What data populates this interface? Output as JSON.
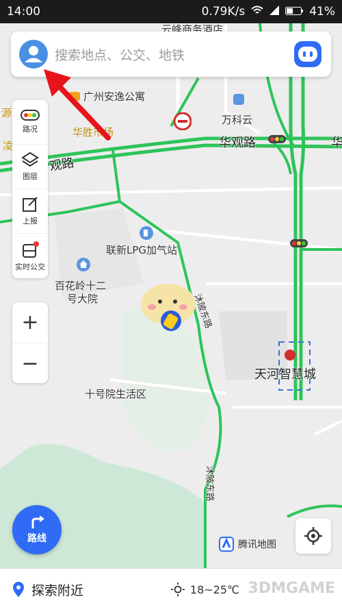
{
  "status_bar": {
    "time": "14:00",
    "network_speed": "0.79K/s",
    "battery": "41%"
  },
  "search": {
    "placeholder": "搜索地点、公交、地铁"
  },
  "side_panel": {
    "items": [
      {
        "label": "路况",
        "icon": "traffic-light-icon"
      },
      {
        "label": "图层",
        "icon": "layers-icon"
      },
      {
        "label": "上报",
        "icon": "edit-report-icon"
      },
      {
        "label": "实时公交",
        "icon": "bus-icon"
      }
    ]
  },
  "zoom": {
    "in": "+",
    "out": "−"
  },
  "route_button": {
    "label": "路线"
  },
  "map_labels": {
    "hotel": "云峰商务酒店",
    "apartment": "广州安逸公寓",
    "market": "华胜市场",
    "wanke": "万科云",
    "huaguan_road_east": "华观路",
    "huaguan_road_west": "观路",
    "lpg": "联新LPG加气站",
    "baihualing": "百花岭十二",
    "baihualing2": "号大院",
    "shipai": "十号院生活区",
    "tianhe": "天河智慧城",
    "mubei_road": "沐陂东路",
    "mubei_road2": "沐陂东路",
    "left_cut1": "源",
    "left_cut2": "凌",
    "right_cut": "华"
  },
  "logo": {
    "text": "腾讯地图"
  },
  "bottom_bar": {
    "explore": "探索附近",
    "temperature": "18~25℃"
  },
  "watermark": "3DMGAME",
  "colors": {
    "accent": "#2f6bf5",
    "road_green": "#2ec45a",
    "map_background": "#eeeeee",
    "arrow_red": "#e8141b"
  }
}
